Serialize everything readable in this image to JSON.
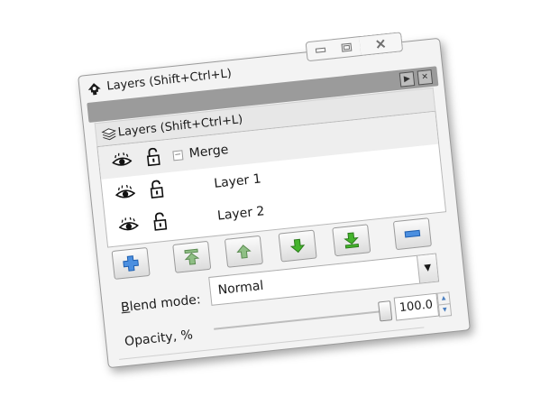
{
  "window": {
    "title": "Layers (Shift+Ctrl+L)",
    "controls": {
      "minimize_icon": "minimize-icon",
      "maximize_icon": "maximize-icon",
      "close_icon": "close-icon"
    }
  },
  "panel": {
    "subtitle": "Layers (Shift+Ctrl+L)",
    "layers": [
      {
        "name": "Merge",
        "collapsible": true,
        "selected": true
      },
      {
        "name": "Layer 1"
      },
      {
        "name": "Layer 2"
      }
    ]
  },
  "toolbar": {
    "buttons": [
      "add-layer",
      "raise-to-top",
      "raise-layer",
      "lower-layer",
      "lower-to-bottom",
      "remove-layer"
    ]
  },
  "blend": {
    "label_prefix": "B",
    "label_rest": "lend mode:",
    "value": "Normal"
  },
  "opacity": {
    "label": "Opacity, %",
    "value": "100.0",
    "level_fraction": 1.0
  },
  "colors": {
    "green_arrow": "#44b42c",
    "blue_button": "#2f73d1",
    "header_gray": "#9b9b9b"
  }
}
